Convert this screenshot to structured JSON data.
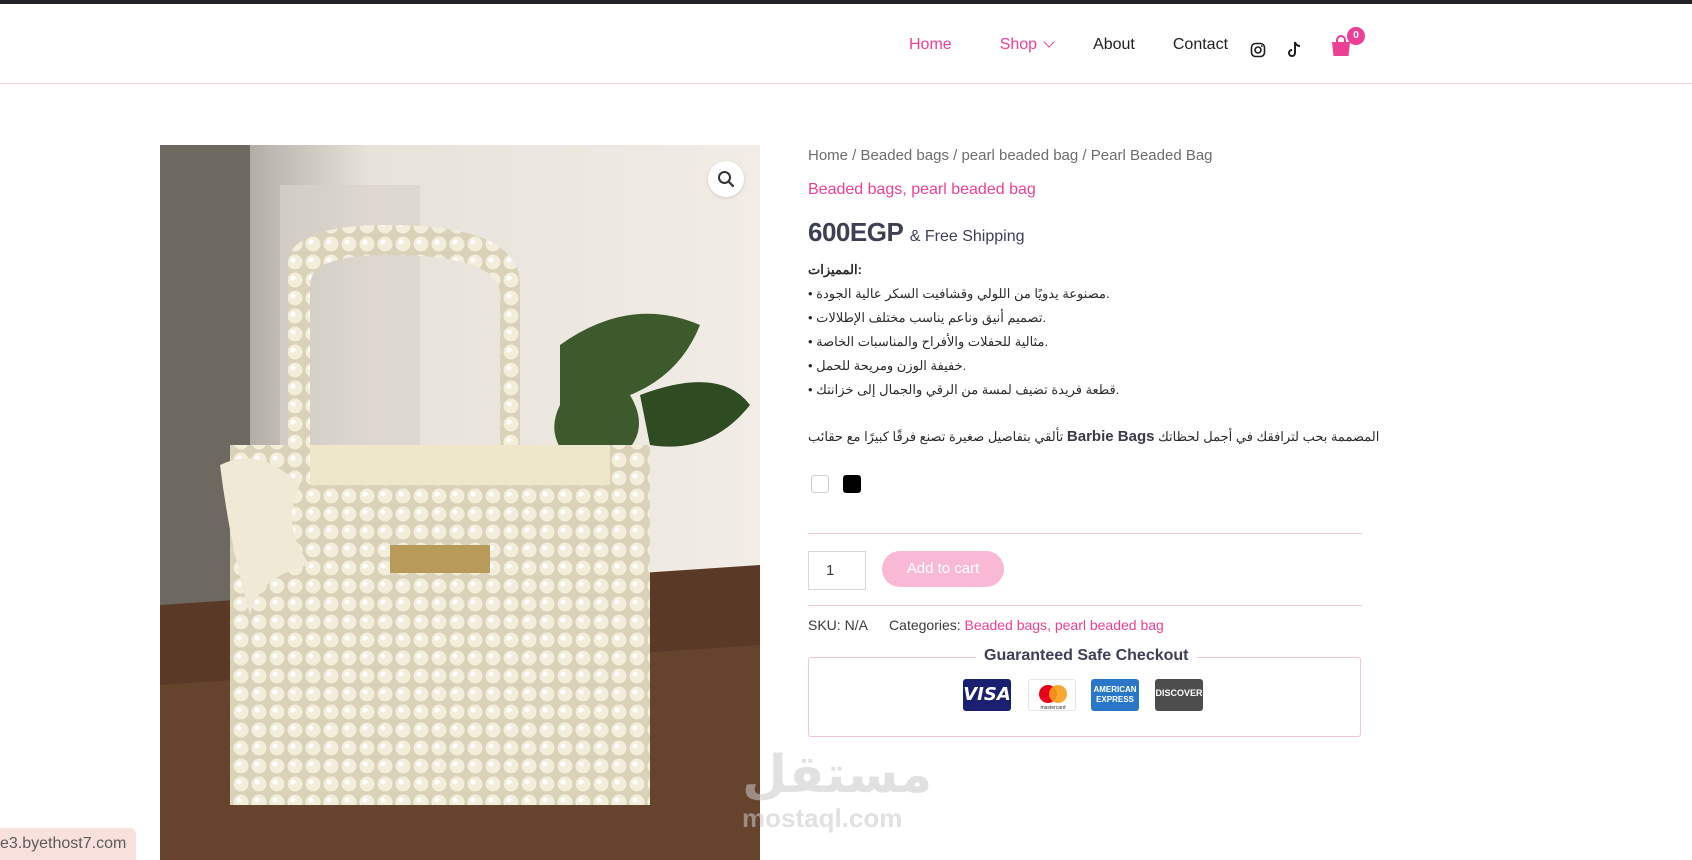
{
  "nav": {
    "home": "Home",
    "shop": "Shop",
    "about": "About",
    "contact": "Contact"
  },
  "cart": {
    "count": "0"
  },
  "breadcrumb": {
    "home": "Home",
    "cat1": "Beaded bags",
    "cat2": "pearl beaded bag",
    "current": "Pearl Beaded Bag",
    "sep": " / "
  },
  "categories_top": {
    "first": "Beaded bags",
    "comma": ", ",
    "second": "pearl beaded bag"
  },
  "price": {
    "amount": "600EGP",
    "shipping": "& Free Shipping"
  },
  "features": {
    "title": "المميزات:",
    "items": [
      "• مصنوعة يدويًا من اللولي وقشافيت السكر عالية الجودة.",
      "• تصميم أنيق وناعم يناسب مختلف الإطلالات.",
      "• مثالية للحفلات والأفراح والمناسبات الخاصة.",
      "• خفيفة الوزن ومريحة للحمل.",
      "• قطعة فريدة تضيف لمسة من الرقي والجمال إلى خزانتك."
    ]
  },
  "description": {
    "before": "المصممة بحب لترافقك في أجمل لحظاتك",
    "brand": "Barbie Bags",
    "after": "تألقي بتفاصيل صغيرة تصنع فرقًا كبيرًا مع حقائب"
  },
  "swatches": [
    "#ffffff",
    "#000000"
  ],
  "purchase": {
    "quantity": "1",
    "add_to_cart": "Add to cart"
  },
  "meta": {
    "sku_label": "SKU:",
    "sku_value": "N/A",
    "categories_label": "Categories:",
    "cat1": "Beaded bags",
    "cat2": "pearl beaded bag"
  },
  "checkout": {
    "title": "Guaranteed Safe Checkout",
    "visa": "VISA",
    "mastercard": "mastercard",
    "amex": "AMERICAN EXPRESS",
    "discover": "DISCOVER"
  },
  "watermark": {
    "arabic": "مستقل",
    "latin": "mostaql.com"
  },
  "status_url": "e3.byethost7.com",
  "colors": {
    "accent": "#ee3f96",
    "button_disabled": "#f9b9d6",
    "divider": "#f2c4d9"
  }
}
